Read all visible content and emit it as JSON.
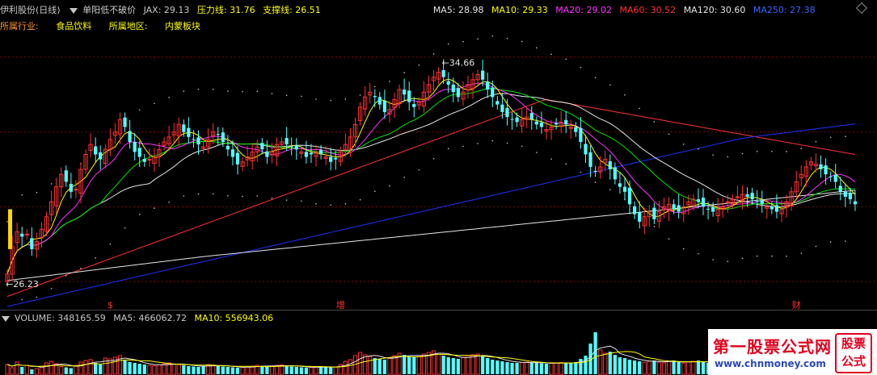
{
  "header": {
    "stock_title": "伊利股份(日线)",
    "indicator_name": "单阳低不破价",
    "jax_label": "JAX: 29.13",
    "pressure_label": "压力线: 31.76",
    "support_label": "支撑线: 26.51",
    "ma5_label": "MA5: 28.98",
    "ma10_label": "MA10: 29.33",
    "ma20_label": "MA20: 29.02",
    "ma60_label": "MA60: 30.52",
    "ma120_label": "MA120: 30.60",
    "ma250_label": "MA250: 27.38"
  },
  "industry": {
    "industry_label": "所属行业:",
    "industry_value": "食品饮料",
    "region_label": "所属地区:",
    "region_value": "内蒙板块"
  },
  "price_panel": {
    "high_label": "34.66",
    "low_label": "26.23",
    "markers": [
      {
        "text": "$",
        "index": 21
      },
      {
        "text": "增",
        "index": 68
      },
      {
        "text": "财",
        "index": 161
      }
    ]
  },
  "volume_header": {
    "volume_label": "VOLUME: 348165.59",
    "vma5_label": "MA5: 466062.72",
    "vma10_label": "MA10: 556943.06"
  },
  "watermark": {
    "main": "第一股票公式网",
    "url": "www.chnmoney.com",
    "seal": "股票公式"
  },
  "colors": {
    "up": "#ff3232",
    "down": "#54ffff",
    "ma5": "#ffffff",
    "ma10": "#ffff00",
    "ma20": "#ff32ff",
    "ma60": "#00e600",
    "ma120": "#e6e6e6",
    "ma250": "#ffaa00",
    "jax": "#ff3232",
    "long_blue": "#1e32ff",
    "grid": "#800000"
  },
  "chart_data": {
    "type": "candlestick",
    "close_series": [
      26.3,
      27.4,
      28.0,
      27.8,
      27.9,
      27.3,
      27.6,
      28.1,
      28.6,
      29.2,
      29.8,
      30.3,
      30.0,
      29.6,
      29.7,
      30.5,
      31.1,
      31.5,
      31.1,
      30.9,
      31.3,
      31.7,
      32.0,
      32.5,
      32.2,
      31.6,
      31.2,
      31.0,
      30.8,
      30.9,
      31.0,
      31.3,
      31.6,
      31.8,
      32.0,
      32.3,
      32.0,
      31.8,
      31.7,
      31.5,
      31.4,
      31.7,
      32.0,
      31.9,
      31.6,
      31.3,
      31.0,
      30.7,
      30.8,
      31.0,
      31.2,
      31.4,
      31.3,
      31.0,
      31.2,
      31.5,
      31.6,
      31.5,
      31.4,
      31.3,
      31.2,
      31.0,
      31.1,
      31.2,
      31.1,
      31.0,
      30.8,
      30.9,
      31.2,
      31.5,
      31.8,
      32.3,
      33.0,
      33.4,
      33.6,
      33.4,
      33.1,
      32.8,
      32.9,
      33.3,
      33.7,
      33.5,
      33.2,
      33.0,
      33.2,
      33.6,
      33.9,
      34.2,
      34.4,
      34.2,
      33.9,
      33.6,
      33.4,
      33.6,
      33.9,
      34.1,
      34.3,
      34.1,
      33.7,
      33.4,
      33.1,
      32.8,
      32.6,
      32.5,
      32.4,
      32.5,
      32.6,
      32.5,
      32.3,
      32.2,
      32.1,
      32.2,
      32.3,
      32.4,
      32.3,
      32.2,
      32.0,
      31.6,
      31.1,
      30.6,
      30.4,
      30.6,
      30.9,
      30.5,
      30.1,
      29.8,
      29.6,
      29.1,
      28.7,
      28.4,
      28.6,
      28.8,
      28.5,
      28.8,
      29.0,
      29.1,
      28.9,
      28.8,
      29.0,
      29.2,
      29.3,
      29.2,
      29.0,
      28.9,
      28.8,
      28.9,
      29.0,
      29.2,
      29.3,
      29.4,
      29.5,
      29.4,
      29.3,
      29.2,
      29.1,
      29.0,
      28.9,
      28.8,
      28.9,
      29.2,
      29.6,
      30.0,
      30.3,
      30.6,
      30.8,
      30.7,
      30.5,
      30.3,
      30.2,
      30.0,
      29.6,
      29.4,
      29.3,
      29.1
    ],
    "ohlc_y_range": [
      25.0,
      36.0
    ],
    "volume": [
      120,
      80,
      150,
      90,
      110,
      60,
      70,
      100,
      140,
      160,
      130,
      95,
      85,
      75,
      110,
      150,
      170,
      180,
      140,
      120,
      200,
      190,
      210,
      230,
      170,
      150,
      140,
      130,
      120,
      110,
      105,
      115,
      130,
      140,
      125,
      120,
      110,
      100,
      95,
      90,
      100,
      120,
      115,
      105,
      95,
      90,
      85,
      80,
      85,
      95,
      100,
      110,
      105,
      95,
      100,
      110,
      115,
      105,
      95,
      90,
      85,
      80,
      85,
      90,
      95,
      90,
      85,
      90,
      120,
      160,
      180,
      230,
      270,
      240,
      220,
      200,
      190,
      180,
      200,
      230,
      260,
      240,
      220,
      210,
      230,
      250,
      270,
      290,
      260,
      230,
      210,
      200,
      190,
      210,
      230,
      240,
      250,
      230,
      200,
      180,
      170,
      160,
      150,
      140,
      140,
      145,
      150,
      145,
      140,
      135,
      130,
      135,
      140,
      145,
      140,
      135,
      150,
      190,
      230,
      380,
      520,
      300,
      260,
      280,
      240,
      210,
      200,
      180,
      170,
      160,
      150,
      160,
      170,
      150,
      140,
      160,
      170,
      150,
      140,
      150,
      160,
      170,
      150,
      140,
      130,
      140,
      150,
      160,
      170,
      160,
      150,
      140,
      130,
      120,
      110,
      120,
      130,
      140,
      150,
      160,
      150,
      140,
      130,
      130,
      125,
      120,
      110,
      105,
      95
    ],
    "vol_y_range": [
      0,
      600
    ]
  }
}
